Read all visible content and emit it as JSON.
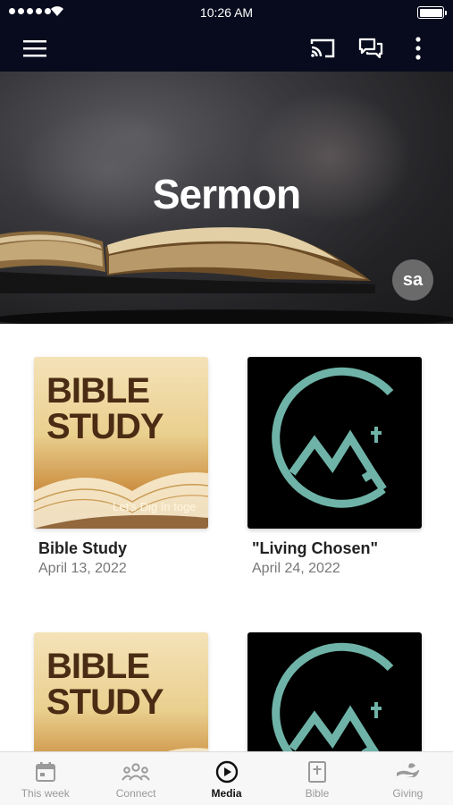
{
  "status_bar": {
    "time": "10:26 AM",
    "icons": [
      "signal-dots",
      "wifi-icon",
      "battery-icon"
    ]
  },
  "nav_bar": {
    "icons": [
      "menu-icon",
      "cast-icon",
      "chat-icon",
      "more-vertical-icon"
    ]
  },
  "hero": {
    "title": "Sermon",
    "badge_text": "sa"
  },
  "media_items": [
    {
      "title": "Bible Study",
      "date": "April 13, 2022",
      "thumbnail": {
        "line1": "BIBLE",
        "line2": "STUDY",
        "tagline": "Let's Dig In toge"
      }
    },
    {
      "title": "\"Living Chosen\"",
      "date": "April 24, 2022",
      "thumbnail": {
        "type": "living-chosen-logo"
      }
    },
    {
      "title": "",
      "date": "",
      "thumbnail": {
        "line1": "BIBLE",
        "line2": "STUDY"
      }
    },
    {
      "title": "",
      "date": "",
      "thumbnail": {
        "type": "living-chosen-logo"
      }
    }
  ],
  "tab_bar": {
    "active": "Media",
    "items": [
      {
        "label": "This week",
        "icon": "calendar-icon"
      },
      {
        "label": "Connect",
        "icon": "people-icon"
      },
      {
        "label": "Media",
        "icon": "play-circle-icon"
      },
      {
        "label": "Bible",
        "icon": "bible-icon"
      },
      {
        "label": "Giving",
        "icon": "giving-hand-icon"
      }
    ]
  },
  "colors": {
    "header_bg": "#070b1d",
    "logo_teal": "#6fb3a8",
    "active_tab": "#111111",
    "inactive_tab": "#9a9a9a"
  }
}
